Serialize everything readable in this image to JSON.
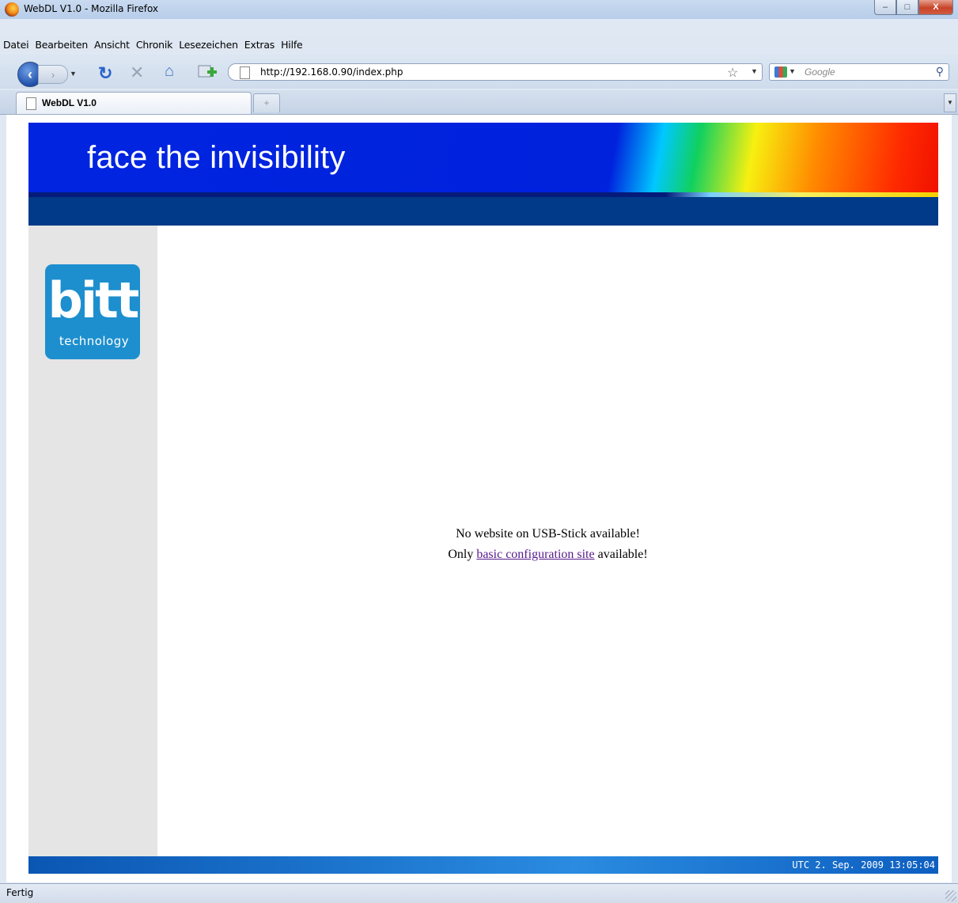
{
  "window": {
    "title": "WebDL V1.0 - Mozilla Firefox",
    "controls": {
      "minimize": "–",
      "maximize": "□",
      "close": "X"
    }
  },
  "menu": {
    "items": [
      "Datei",
      "Bearbeiten",
      "Ansicht",
      "Chronik",
      "Lesezeichen",
      "Extras",
      "Hilfe"
    ]
  },
  "navbar": {
    "url": "http://192.168.0.90/index.php",
    "search_placeholder": "Google",
    "icons": {
      "back": "back-arrow-icon",
      "forward": "forward-arrow-icon",
      "reload": "reload-icon",
      "stop": "stop-icon",
      "home": "home-icon",
      "bookmark_add": "bookmark-add-icon",
      "star": "star-icon",
      "search_engine": "google-icon",
      "search": "magnifier-icon"
    }
  },
  "tabs": {
    "active_label": "WebDL V1.0",
    "new_tab": "+"
  },
  "page": {
    "banner_text": "face the invisibility",
    "logo_main": "bitt",
    "logo_sub": "technology",
    "message_line1": "No website on USB-Stick available!",
    "message_line2_prefix": "Only ",
    "message_link": "basic configuration site",
    "message_line2_suffix": " available!",
    "footer_time": "UTC 2. Sep. 2009 13:05:04",
    "colors": {
      "banner_blue": "#0024e0",
      "subbar": "#003a88",
      "sidebar": "#e5e5e5",
      "logo_bg": "#1d8fce",
      "link_visited": "#551a8b"
    }
  },
  "status": {
    "text": "Fertig"
  }
}
